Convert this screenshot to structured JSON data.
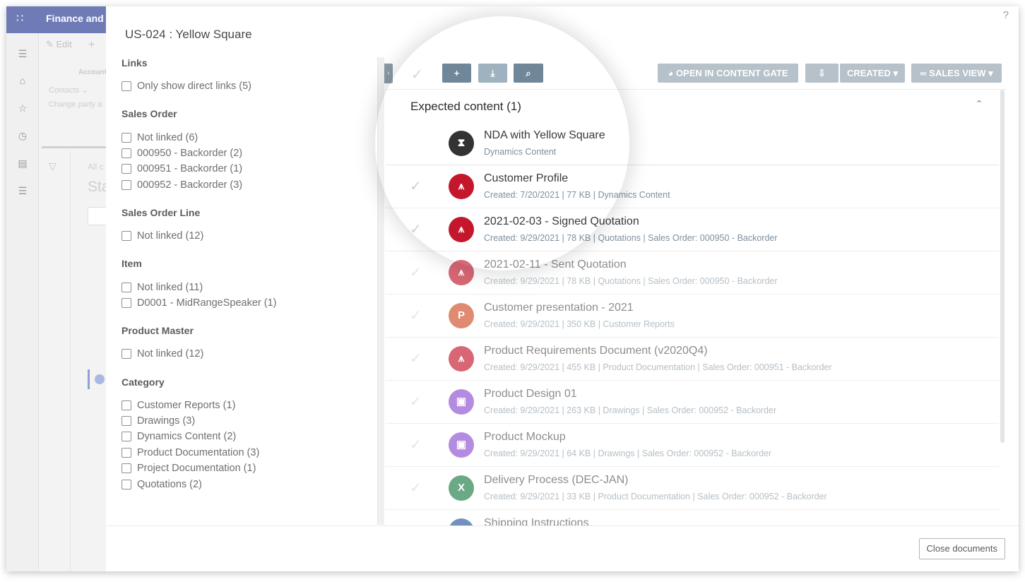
{
  "app": {
    "title": "Finance and"
  },
  "background": {
    "edit_label": "Edit",
    "acc_label": "Account",
    "contacts_label": "Contacts ⌄",
    "change_label": "Change party a",
    "all_label": "All c",
    "sta_label": "Sta"
  },
  "dialog": {
    "title": "US-024 : Yellow Square",
    "help": "?",
    "close_label": "Close documents"
  },
  "filters": {
    "groups": [
      {
        "title": "Links",
        "options": [
          "Only show direct links (5)"
        ]
      },
      {
        "title": "Sales Order",
        "options": [
          "Not linked (6)",
          "000950 - Backorder (2)",
          "000951 - Backorder (1)",
          "000952 - Backorder (3)"
        ]
      },
      {
        "title": "Sales Order Line",
        "options": [
          "Not linked (12)"
        ]
      },
      {
        "title": "Item",
        "options": [
          "Not linked (11)",
          "D0001 - MidRangeSpeaker (1)"
        ]
      },
      {
        "title": "Product Master",
        "options": [
          "Not linked (12)"
        ]
      },
      {
        "title": "Category",
        "options": [
          "Customer Reports (1)",
          "Drawings (3)",
          "Dynamics Content (2)",
          "Product Documentation (3)",
          "Project Documentation (1)",
          "Quotations (2)"
        ]
      }
    ]
  },
  "toolbar": {
    "add_icon": "+",
    "open_label": "OPEN IN CONTENT GATE",
    "created_label": "CREATED",
    "view_label": "SALES VIEW"
  },
  "list": {
    "section_title": "Expected content (1)",
    "rows": [
      {
        "name": "NDA with Yellow Square",
        "meta": "Dynamics Content",
        "icon": "hourglass-icon",
        "color": "#333333",
        "glyph": "⧗"
      },
      {
        "name": "Customer Profile",
        "meta": "Created: 7/20/2021 | 77 KB | Dynamics Content",
        "icon": "pdf-icon",
        "color": "#c4172c",
        "glyph": "⩚"
      },
      {
        "name": "2021-02-03 - Signed Quotation",
        "meta": "Created: 9/29/2021 | 78 KB | Quotations | Sales Order: 000950 - Backorder",
        "icon": "pdf-icon",
        "color": "#c4172c",
        "glyph": "⩚"
      },
      {
        "name": "2021-02-11 - Sent Quotation",
        "meta": "Created: 9/29/2021 | 78 KB | Quotations | Sales Order: 000950 - Backorder",
        "icon": "pdf-icon",
        "color": "#c4172c",
        "glyph": "⩚"
      },
      {
        "name": "Customer presentation - 2021",
        "meta": "Created: 9/29/2021 | 350 KB | Customer Reports",
        "icon": "powerpoint-icon",
        "color": "#d04c26",
        "glyph": "P"
      },
      {
        "name": "Product Requirements Document (v2020Q4)",
        "meta": "Created: 9/29/2021 | 455 KB | Product Documentation | Sales Order: 000951 - Backorder",
        "icon": "pdf-icon",
        "color": "#c4172c",
        "glyph": "⩚"
      },
      {
        "name": "Product Design 01",
        "meta": "Created: 9/29/2021 | 263 KB | Drawings | Sales Order: 000952 - Backorder",
        "icon": "image-icon",
        "color": "#8c4fd1",
        "glyph": "▣"
      },
      {
        "name": "Product Mockup",
        "meta": "Created: 9/29/2021 | 64 KB | Drawings | Sales Order: 000952 - Backorder",
        "icon": "image-icon",
        "color": "#8c4fd1",
        "glyph": "▣"
      },
      {
        "name": "Delivery Process (DEC-JAN)",
        "meta": "Created: 9/29/2021 | 33 KB | Product Documentation | Sales Order: 000952 - Backorder",
        "icon": "excel-icon",
        "color": "#1d7a44",
        "glyph": "X"
      },
      {
        "name": "Shipping Instructions",
        "meta": "",
        "icon": "word-icon",
        "color": "#2b579a",
        "glyph": "W"
      }
    ]
  }
}
